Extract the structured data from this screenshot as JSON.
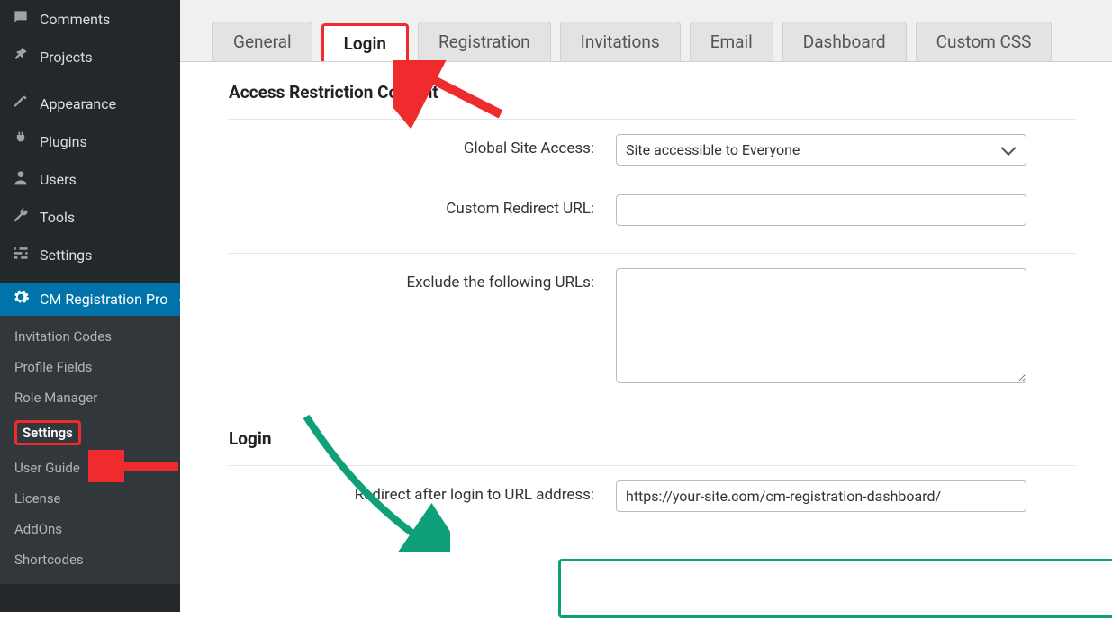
{
  "sidebar": {
    "menu": [
      {
        "icon": "comment",
        "label": "Comments"
      },
      {
        "icon": "pin",
        "label": "Projects"
      },
      {
        "sep": true
      },
      {
        "icon": "brush",
        "label": "Appearance"
      },
      {
        "icon": "plug",
        "label": "Plugins"
      },
      {
        "icon": "user",
        "label": "Users"
      },
      {
        "icon": "wrench",
        "label": "Tools"
      },
      {
        "icon": "sliders",
        "label": "Settings"
      },
      {
        "sep": true
      },
      {
        "icon": "gear",
        "label": "CM Registration Pro",
        "current": true
      }
    ],
    "submenu": [
      "Invitation Codes",
      "Profile Fields",
      "Role Manager",
      "Settings",
      "User Guide",
      "License",
      "AddOns",
      "Shortcodes"
    ],
    "submenu_active": "Settings"
  },
  "tabs": [
    "General",
    "Login",
    "Registration",
    "Invitations",
    "Email",
    "Dashboard",
    "Custom CSS"
  ],
  "tab_active": "Login",
  "sections": {
    "access": {
      "title": "Access Restriction Content",
      "global_access": {
        "label": "Global Site Access:",
        "value": "Site accessible to Everyone"
      },
      "custom_redirect": {
        "label": "Custom Redirect URL:",
        "value": ""
      },
      "exclude_urls": {
        "label": "Exclude the following URLs:",
        "value": ""
      }
    },
    "login": {
      "title": "Login",
      "redirect": {
        "label": "Redirect after login to URL address:",
        "value": "https://your-site.com/cm-registration-dashboard/"
      }
    }
  }
}
